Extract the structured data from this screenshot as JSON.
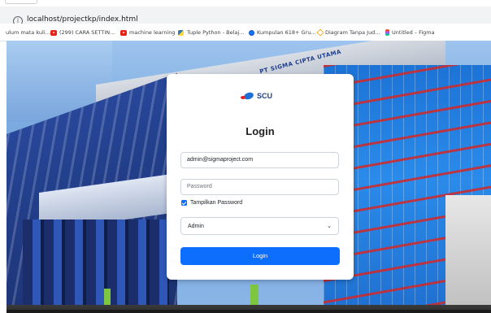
{
  "browser": {
    "url": "localhost/projectkp/index.html"
  },
  "bookmarks": [
    {
      "label": "ulum mata kuli...",
      "icon": "none"
    },
    {
      "label": "(299) CARA SETTIN...",
      "icon": "youtube-icon"
    },
    {
      "label": "machine learning",
      "icon": "youtube-icon"
    },
    {
      "label": "Tuple Python - Belaj...",
      "icon": "python-icon"
    },
    {
      "label": "Kumpulan 618+ Gru...",
      "icon": "globe-icon"
    },
    {
      "label": "Diagram Tanpa Jud...",
      "icon": "diagram-icon"
    },
    {
      "label": "Untitled – Figma",
      "icon": "figma-icon"
    }
  ],
  "hero": {
    "building_sign": "PT SIGMA CIPTA UTAMA"
  },
  "login": {
    "logo_text": "SCU",
    "title": "Login",
    "email_value": "admin@sigmaproject.com",
    "password_placeholder": "Password",
    "show_password_label": "Tampilkan Password",
    "show_password_checked": true,
    "role_value": "Admin",
    "button_label": "Login",
    "accent_color": "#0d6efd"
  }
}
